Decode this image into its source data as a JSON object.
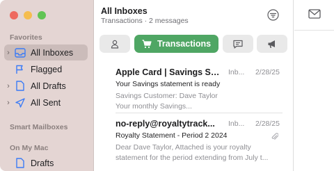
{
  "sidebar": {
    "sections": {
      "favorites": "Favorites",
      "smart_mailboxes": "Smart Mailboxes",
      "on_my_mac": "On My Mac"
    },
    "items": [
      {
        "label": "All Inboxes",
        "icon": "inbox-tray-icon",
        "selected": true
      },
      {
        "label": "Flagged",
        "icon": "flag-icon"
      },
      {
        "label": "All Drafts",
        "icon": "draft-document-icon"
      },
      {
        "label": "All Sent",
        "icon": "paper-plane-icon"
      },
      {
        "label": "Drafts",
        "icon": "draft-document-icon"
      }
    ]
  },
  "list": {
    "title": "All Inboxes",
    "subtitle": "Transactions · 2 messages",
    "tabs": [
      {
        "name": "person",
        "icon": "person-icon"
      },
      {
        "name": "transactions",
        "label": "Transactions",
        "icon": "cart-icon",
        "active": true
      },
      {
        "name": "updates",
        "icon": "chat-bubble-icon"
      },
      {
        "name": "promotions",
        "icon": "megaphone-icon"
      }
    ],
    "messages": [
      {
        "sender": "Apple Card | Savings Su...",
        "account": "Inb...",
        "date": "2/28/25",
        "subject": "Your Savings statement is ready",
        "preview1": "Savings Customer: Dave Taylor",
        "preview2": "Your monthly Savings..."
      },
      {
        "sender": "no-reply@royaltytrack...",
        "account": "Inb...",
        "date": "2/28/25",
        "subject": "Royalty Statement - Period 2 2024",
        "preview1": "Dear Dave Taylor, Attached is your royalty",
        "preview2": "statement for the period extending from July t...",
        "has_attachment": true
      }
    ]
  },
  "colors": {
    "sidebar_bg": "#e4d5d3",
    "selected_bg": "#cbbcba",
    "accent_green": "#4fa664",
    "icon_blue": "#3b7bf6"
  }
}
